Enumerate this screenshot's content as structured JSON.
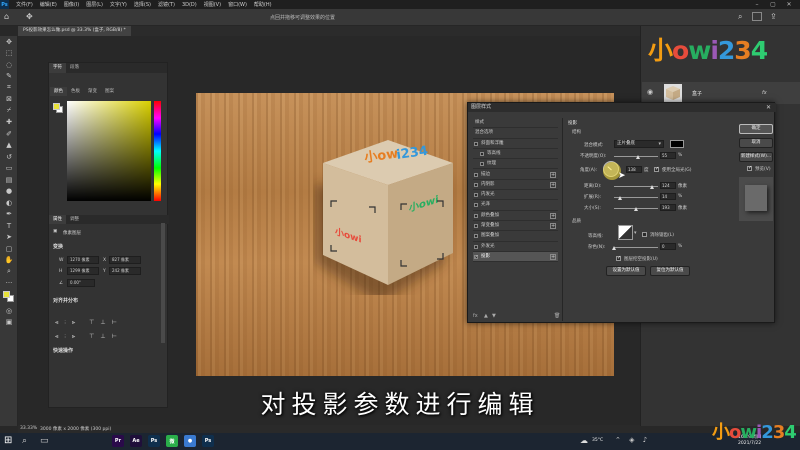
{
  "menubar": {
    "app_icon": "Ps",
    "items": [
      "文件(F)",
      "编辑(E)",
      "图像(I)",
      "图层(L)",
      "文字(Y)",
      "选择(S)",
      "滤镜(T)",
      "3D(D)",
      "视图(V)",
      "窗口(W)",
      "帮助(H)"
    ]
  },
  "optionsbar": {
    "title": "点回并拖移可调整效果的位置"
  },
  "document_tab": {
    "label": "PS投影效果怎么做.psd @ 33.3% (盒子, RGB/8) *"
  },
  "left_panel": {
    "top_tabs": [
      "字符",
      "段落"
    ],
    "color_tabs": [
      "颜色",
      "色板",
      "渐变",
      "图案"
    ],
    "props_tabs": [
      "属性",
      "调整"
    ],
    "pixel_layer_label": "像素图层",
    "transform_title": "变换",
    "w_label": "W",
    "w_value": "1270 像素",
    "x_label": "X",
    "x_value": "827 像素",
    "h_label": "H",
    "h_value": "1299 像素",
    "y_label": "Y",
    "y_value": "242 像素",
    "angle_value": "0.00°",
    "align_title": "对齐并分布",
    "quick_title": "快速操作"
  },
  "canvas": {
    "subtitle": "对投影参数进行编辑"
  },
  "watermark": {
    "chars": [
      "小",
      "o",
      "w",
      "i",
      "2",
      "3",
      "4"
    ],
    "colors": [
      "#f39c12",
      "#e74c3c",
      "#27ae60",
      "#9b59b6",
      "#3498db",
      "#e67e22",
      "#2ecc71"
    ]
  },
  "layers": {
    "layer_name": "盒子",
    "fx": "fx"
  },
  "dialog": {
    "title": "图层样式",
    "close": "✕",
    "style_list": [
      {
        "label": "样式",
        "type": "header"
      },
      {
        "label": "混合选项",
        "type": "header"
      },
      {
        "label": "斜面和浮雕",
        "type": "check",
        "checked": false
      },
      {
        "label": "等高线",
        "type": "indent",
        "checked": false
      },
      {
        "label": "纹理",
        "type": "indent",
        "checked": false
      },
      {
        "label": "描边",
        "type": "check",
        "checked": false,
        "plus": true
      },
      {
        "label": "内阴影",
        "type": "check",
        "checked": false,
        "plus": true
      },
      {
        "label": "内发光",
        "type": "check",
        "checked": false
      },
      {
        "label": "光泽",
        "type": "check",
        "checked": false
      },
      {
        "label": "颜色叠加",
        "type": "check",
        "checked": false,
        "plus": true
      },
      {
        "label": "渐变叠加",
        "type": "check",
        "checked": false,
        "plus": true
      },
      {
        "label": "图案叠加",
        "type": "check",
        "checked": false
      },
      {
        "label": "外发光",
        "type": "check",
        "checked": false
      },
      {
        "label": "投影",
        "type": "check",
        "checked": true,
        "plus": true,
        "selected": true
      }
    ],
    "fx_label": "fx",
    "section_shadow": "投影",
    "section_structure": "结构",
    "blend_label": "混合模式:",
    "blend_value": "正片叠底",
    "opacity_label": "不透明度(O):",
    "opacity_value": "55",
    "opacity_fraction": 0.55,
    "percent": "%",
    "angle_label": "角度(A):",
    "angle_value": "138",
    "degree": "度",
    "global_light_label": "使用全局光(G)",
    "distance_label": "距离(D):",
    "distance_value": "124",
    "spread_label": "扩展(R):",
    "spread_value": "14",
    "size_label": "大小(S):",
    "size_value": "193",
    "px": "像素",
    "section_quality": "品质",
    "contour_label": "等高线:",
    "antialias_label": "消除锯齿(L)",
    "noise_label": "杂色(N):",
    "noise_value": "0",
    "knockout_label": "图层挖空投影(U)",
    "btn_default": "设置为默认值",
    "btn_reset": "复位为默认值",
    "btn_ok": "确定",
    "btn_cancel": "取消",
    "btn_new_style": "新建样式(W)...",
    "preview_label": "预览(V)"
  },
  "statusbar": {
    "zoom": "33.33%",
    "doc": "3000 像素 x 2000 像素 (300 ppi)"
  },
  "taskbar": {
    "icons": [
      {
        "name": "pr-icon",
        "label": "Pr",
        "color": "#2a0a4a"
      },
      {
        "name": "ae-icon",
        "label": "Ae",
        "color": "#1f0f3a"
      },
      {
        "name": "ps-icon",
        "label": "Ps",
        "color": "#0f2f4d"
      },
      {
        "name": "wechat-icon",
        "label": "微",
        "color": "#2aae4a"
      },
      {
        "name": "chrome-icon",
        "label": "●",
        "color": "#3a7ad0"
      },
      {
        "name": "ps2-icon",
        "label": "Ps",
        "color": "#0f2f4d"
      }
    ],
    "weather": "35°C",
    "time": "16:29 周四",
    "date": "2021/7/22"
  }
}
